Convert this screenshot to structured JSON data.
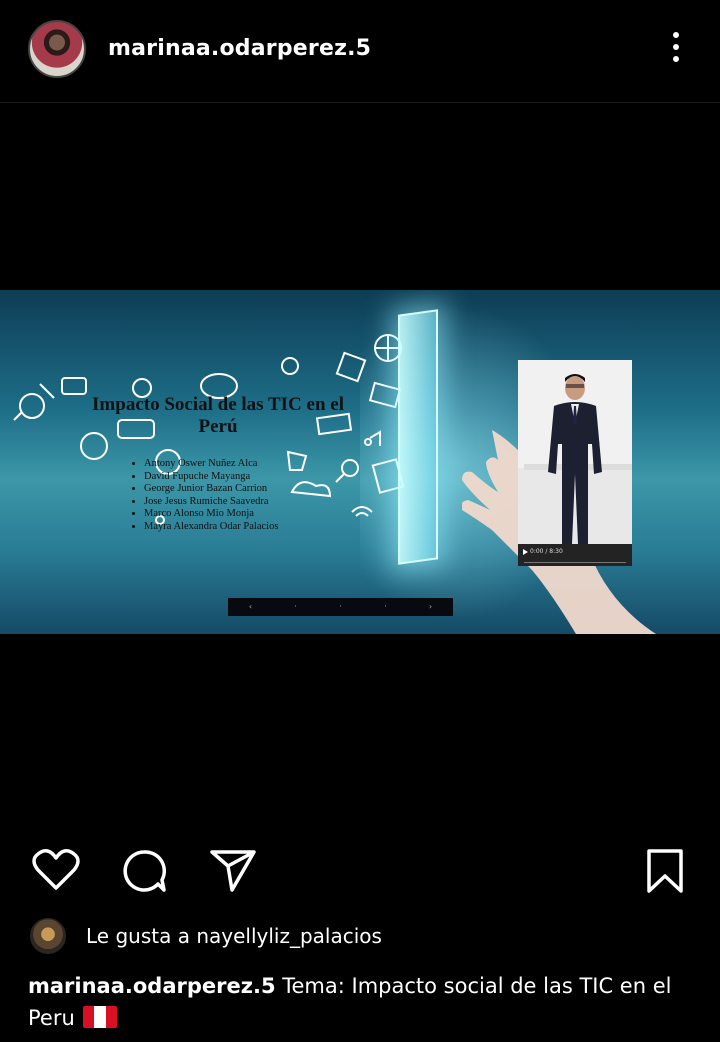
{
  "post": {
    "username": "marinaa.odarperez.5",
    "more_icon": "more-vertical-icon"
  },
  "slide": {
    "title": "Impacto Social de las TIC en el Perú",
    "members": [
      "Antony Oswer Nuñez Alca",
      "David Fupuche Mayanga",
      "George Junior Bazan Carrion",
      "Jose Jesus Rumiche Saavedra",
      "Marco Alonso Mio Monja",
      "Mayra Alexandra Odar Palacios"
    ],
    "video_time": "0:00 / 8:30"
  },
  "actions": {
    "like_icon": "heart-icon",
    "comment_icon": "comment-icon",
    "share_icon": "send-icon",
    "save_icon": "bookmark-icon"
  },
  "likes": {
    "text": "Le gusta a nayellyliz_palacios"
  },
  "caption": {
    "username": "marinaa.odarperez.5",
    "text": "Tema: Impacto social de las TIC en el Peru"
  }
}
